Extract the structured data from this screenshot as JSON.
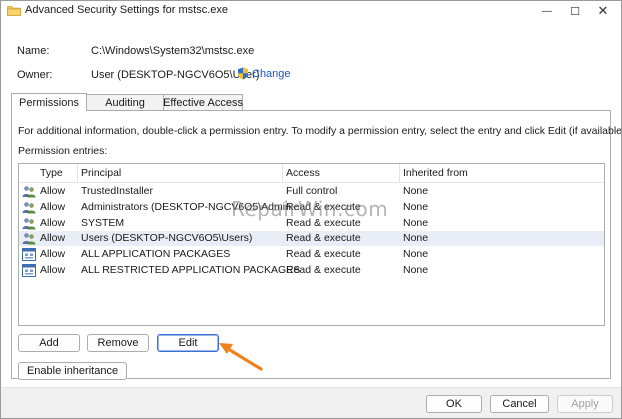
{
  "window": {
    "title": "Advanced Security Settings for mstsc.exe",
    "minimize_glyph": "—",
    "maximize_glyph": "☐",
    "close_glyph": "✕"
  },
  "info": {
    "name_label": "Name:",
    "name_value": "C:\\Windows\\System32\\mstsc.exe",
    "owner_label": "Owner:",
    "owner_value": "User (DESKTOP-NGCV6O5\\User)",
    "change_link": "Change"
  },
  "tabs": [
    {
      "label": "Permissions",
      "active": true
    },
    {
      "label": "Auditing",
      "active": false
    },
    {
      "label": "Effective Access",
      "active": false
    }
  ],
  "permissions": {
    "description": "For additional information, double-click a permission entry. To modify a permission entry, select the entry and click Edit (if available).",
    "entries_label": "Permission entries:",
    "columns": [
      "Type",
      "Principal",
      "Access",
      "Inherited from"
    ],
    "rows": [
      {
        "icon": "users-icon",
        "type": "Allow",
        "principal": "TrustedInstaller",
        "access": "Full control",
        "inherited": "None"
      },
      {
        "icon": "users-icon",
        "type": "Allow",
        "principal": "Administrators (DESKTOP-NGCV6O5\\Admin...",
        "access": "Read & execute",
        "inherited": "None"
      },
      {
        "icon": "users-icon",
        "type": "Allow",
        "principal": "SYSTEM",
        "access": "Read & execute",
        "inherited": "None"
      },
      {
        "icon": "users-icon",
        "type": "Allow",
        "principal": "Users (DESKTOP-NGCV6O5\\Users)",
        "access": "Read & execute",
        "inherited": "None",
        "selected": true
      },
      {
        "icon": "app-package-icon",
        "type": "Allow",
        "principal": "ALL APPLICATION PACKAGES",
        "access": "Read & execute",
        "inherited": "None"
      },
      {
        "icon": "app-package-icon",
        "type": "Allow",
        "principal": "ALL RESTRICTED APPLICATION PACKAGES",
        "access": "Read & execute",
        "inherited": "None"
      }
    ]
  },
  "buttons": {
    "add": "Add",
    "remove": "Remove",
    "edit": "Edit",
    "enable_inheritance": "Enable inheritance",
    "ok": "OK",
    "cancel": "Cancel",
    "apply": "Apply"
  },
  "watermark": "RepairWin.com",
  "colors": {
    "accent": "#1a56b8",
    "arrow": "#f0821e",
    "selected_row": "#e9eef6"
  }
}
